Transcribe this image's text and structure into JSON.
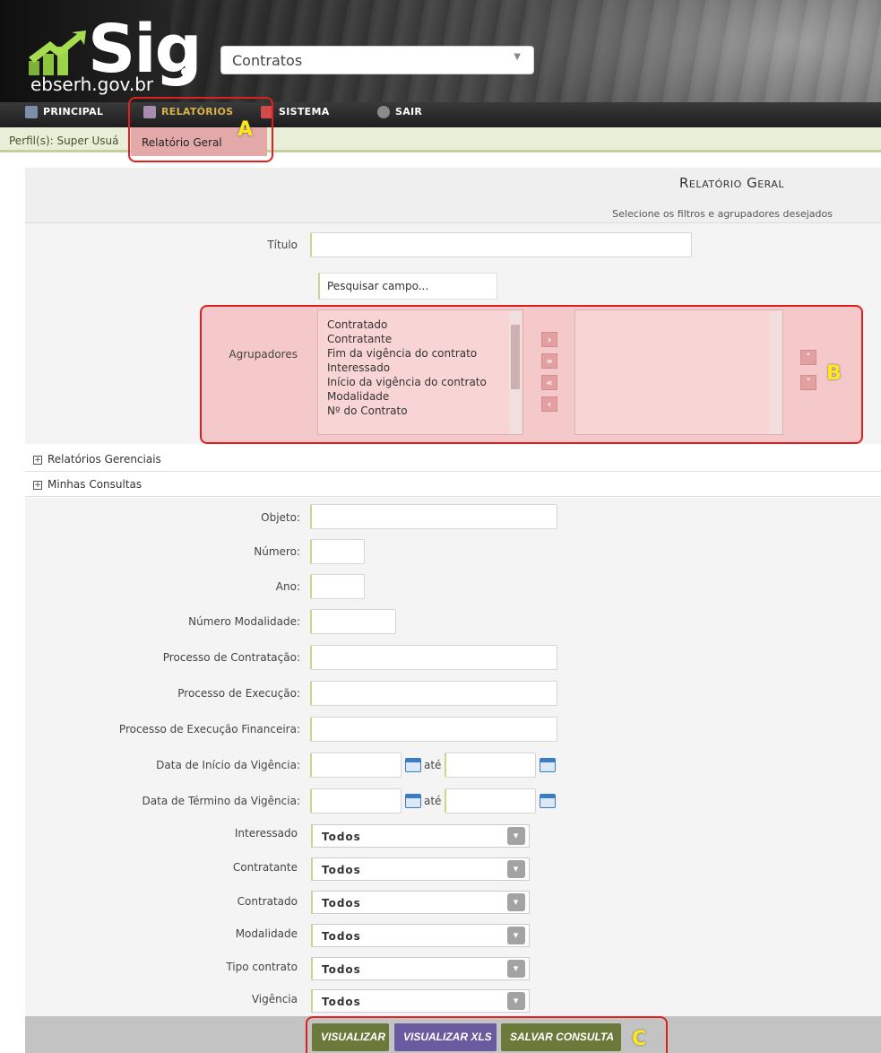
{
  "header": {
    "logo_text": "Sig",
    "logo_domain": "ebserh.gov.br",
    "system_selected": "Contratos"
  },
  "menu": {
    "items": [
      {
        "label": "PRINCIPAL",
        "icon": "home-icon"
      },
      {
        "label": "RELATÓRIOS",
        "icon": "chart-icon"
      },
      {
        "label": "SISTEMA",
        "icon": "gear-icon"
      },
      {
        "label": "SAIR",
        "icon": "power-icon"
      }
    ],
    "dropdown_item": "Relatório Geral"
  },
  "profile": {
    "text": "Perfil(s): Super Usuá"
  },
  "annotations": [
    "A",
    "B",
    "C"
  ],
  "panel": {
    "title": "Relatório Geral",
    "subtitle": "Selecione os filtros e agrupadores desejados"
  },
  "form": {
    "titulo_label": "Título",
    "search_placeholder": "Pesquisar campo...",
    "agrupadores_label": "Agrupadores",
    "agrupadores_options": [
      "Contratado",
      "Contratante",
      "Fim da vigência do contrato",
      "Interessado",
      "Início da vigência do contrato",
      "Modalidade",
      "Nº do Contrato"
    ],
    "links": [
      "Relatórios Gerenciais",
      "Minhas Consultas"
    ],
    "fields": [
      "Objeto:",
      "Número:",
      "Ano:",
      "Número Modalidade:",
      "Processo de Contratação:",
      "Processo de Execução:",
      "Processo de Execução Financeira:",
      "Data de Início da Vigência:",
      "Data de Término da Vigência:"
    ],
    "ate_label": "até",
    "selects": [
      {
        "label": "Interessado",
        "value": "Todos"
      },
      {
        "label": "Contratante",
        "value": "Todos"
      },
      {
        "label": "Contratado",
        "value": "Todos"
      },
      {
        "label": "Modalidade",
        "value": "Todos"
      },
      {
        "label": "Tipo contrato",
        "value": "Todos"
      },
      {
        "label": "Vigência",
        "value": "Todos"
      }
    ]
  },
  "buttons": {
    "visualizar": "VISUALIZAR",
    "visualizar_xls": "VISUALIZAR XLS",
    "salvar_consulta": "SALVAR CONSULTA"
  },
  "colors": {
    "btn_green": "#6b7a3a",
    "btn_purple": "#6a5aa0",
    "annotation_red": "#e02020",
    "annotation_letter": "#ffe81a",
    "menu_active": "#d7b24a"
  }
}
